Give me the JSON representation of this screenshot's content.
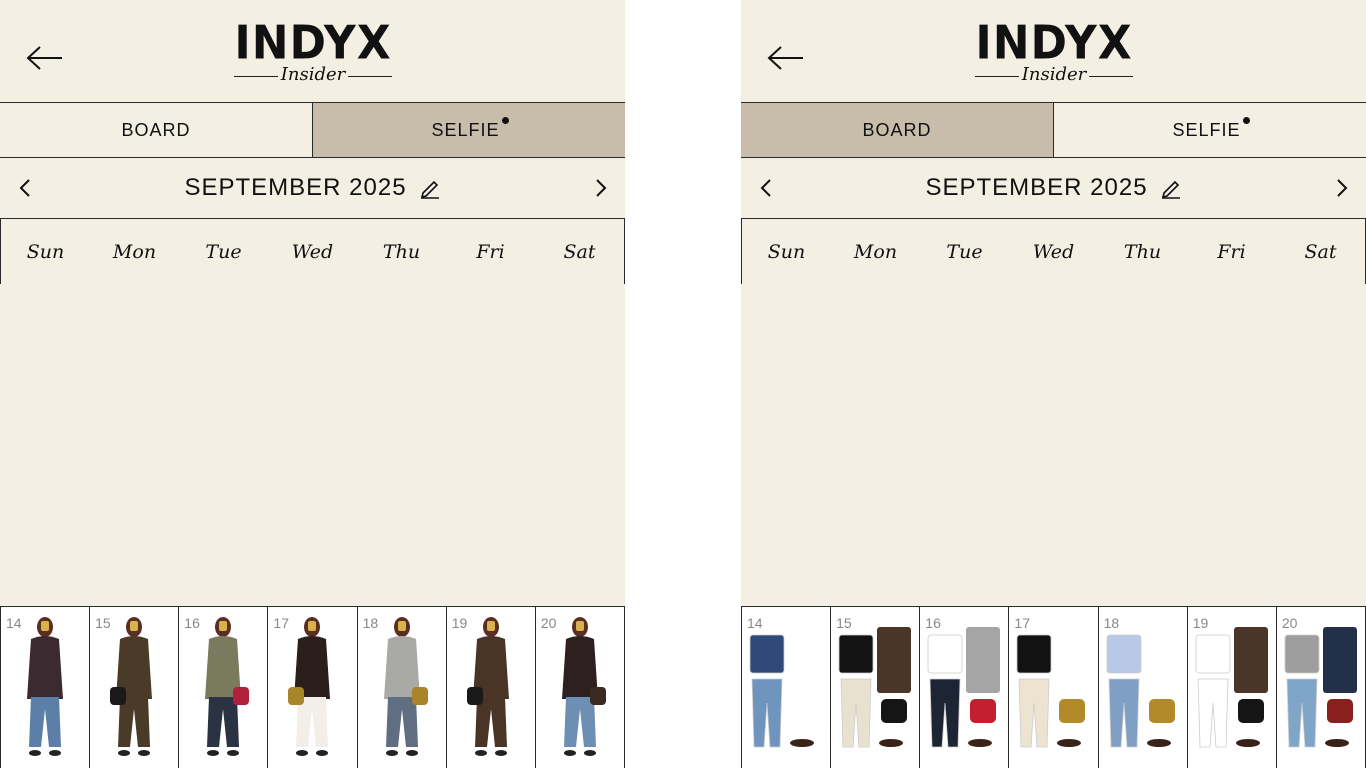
{
  "screens": [
    {
      "id": "left",
      "logo": {
        "main": "INDYX",
        "sub": "Insider"
      },
      "tabs": [
        {
          "label": "BOARD",
          "active": false
        },
        {
          "label": "SELFIE",
          "active": true
        }
      ],
      "month_title": "SEPTEMBER 2025",
      "weekdays": [
        "Sun",
        "Mon",
        "Tue",
        "Wed",
        "Thu",
        "Fri",
        "Sat"
      ],
      "days": [
        "14",
        "15",
        "16",
        "17",
        "18",
        "19",
        "20"
      ],
      "view": "selfie"
    },
    {
      "id": "right",
      "logo": {
        "main": "INDYX",
        "sub": "Insider"
      },
      "tabs": [
        {
          "label": "BOARD",
          "active": true
        },
        {
          "label": "SELFIE",
          "active": false
        }
      ],
      "month_title": "SEPTEMBER 2025",
      "weekdays": [
        "Sun",
        "Mon",
        "Tue",
        "Wed",
        "Thu",
        "Fri",
        "Sat"
      ],
      "days": [
        "14",
        "15",
        "16",
        "17",
        "18",
        "19",
        "20"
      ],
      "view": "board"
    }
  ],
  "colors": {
    "background": "#f3efe3",
    "tab_active": "#c8bcab",
    "border": "#2a2a2a",
    "text": "#111111",
    "day_number": "#888888"
  },
  "icons": {
    "back": "arrow-left-icon",
    "edit": "pencil-icon",
    "prev": "chevron-left-icon",
    "next": "chevron-right-icon",
    "notify": "dot-icon"
  }
}
